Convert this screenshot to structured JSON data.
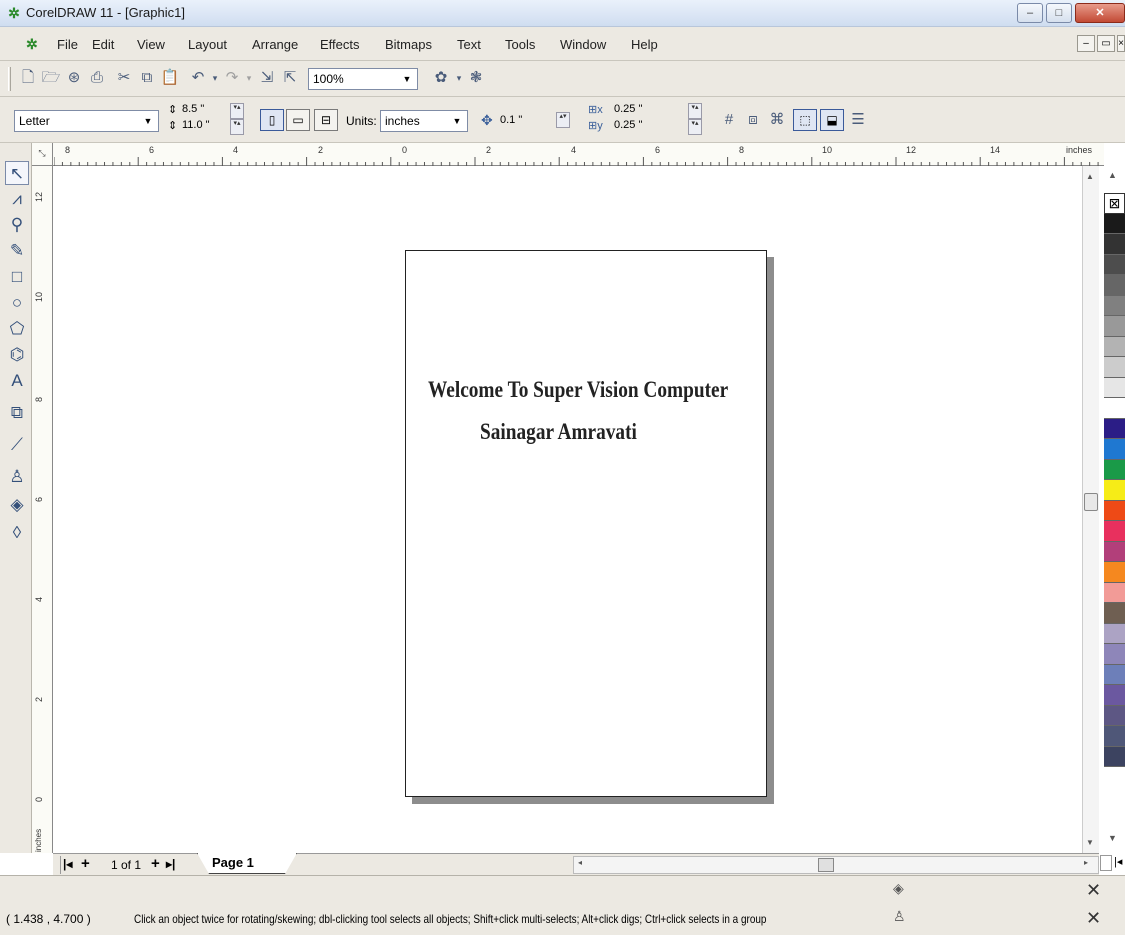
{
  "window": {
    "title": "CorelDRAW 11 - [Graphic1]",
    "minimize": "–",
    "maximize": "□",
    "close": "✕"
  },
  "menu": [
    "File",
    "Edit",
    "View",
    "Layout",
    "Arrange",
    "Effects",
    "Bitmaps",
    "Text",
    "Tools",
    "Window",
    "Help"
  ],
  "standard_toolbar": {
    "zoom": "100%"
  },
  "property_bar": {
    "paper_type": "Letter",
    "width": "8.5 \"",
    "height": "11.0 \"",
    "units_label": "Units:",
    "units_value": "inches",
    "nudge": "0.1 \"",
    "dup_x": "0.25 \"",
    "dup_y": "0.25 \""
  },
  "ruler": {
    "unit": "inches",
    "h_ticks": [
      "8",
      "6",
      "4",
      "2",
      "0",
      "2",
      "4",
      "6",
      "8",
      "10",
      "12",
      "14"
    ],
    "v_ticks": [
      "12",
      "10",
      "8",
      "6",
      "4",
      "2",
      "0"
    ]
  },
  "document": {
    "line1": "Welcome To Super Vision Computer",
    "line2": "Sainagar Amravati"
  },
  "page_nav": {
    "position": "1 of 1",
    "tab": "Page 1"
  },
  "status": {
    "coords": "( 1.438 , 4.700 )",
    "hint": "Click an object twice for rotating/skewing; dbl-clicking tool selects all objects; Shift+click multi-selects; Alt+click digs; Ctrl+click selects in a group"
  },
  "palette_colors": [
    "#ffffff",
    "#1a1a1a",
    "#333333",
    "#4d4d4d",
    "#666666",
    "#808080",
    "#999999",
    "#b3b3b3",
    "#cccccc",
    "#e6e6e6",
    "#ffffff",
    "#2b1d86",
    "#1f78d1",
    "#1a9a48",
    "#f6ec17",
    "#ee4a16",
    "#e8305e",
    "#b23f7a",
    "#f5881f",
    "#f29b97",
    "#6f5f52",
    "#aca3c4",
    "#8e86b9",
    "#6d7fb9",
    "#6b58a0",
    "#5d5784",
    "#4f5778",
    "#3c4360"
  ]
}
